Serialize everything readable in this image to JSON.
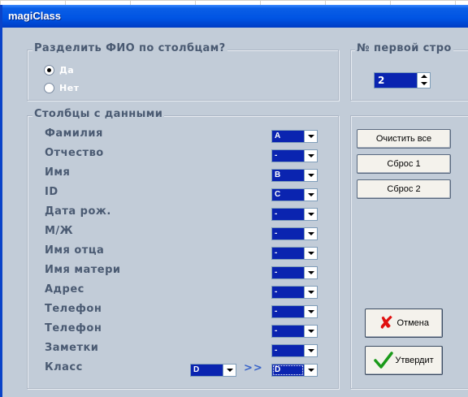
{
  "window": {
    "title": "magiClass"
  },
  "split_group": {
    "legend": "Разделить ФИО по столбцам?",
    "options": [
      {
        "label": "Да",
        "selected": true
      },
      {
        "label": "Нет",
        "selected": false
      }
    ]
  },
  "first_row_group": {
    "legend": "№ первой стро",
    "value": "2"
  },
  "columns_group": {
    "legend": "Столбцы с данными",
    "fields": [
      {
        "label": "Фамилия",
        "value": "A"
      },
      {
        "label": "Отчество",
        "value": "-"
      },
      {
        "label": "Имя",
        "value": "B"
      },
      {
        "label": "ID",
        "value": "C"
      },
      {
        "label": "Дата рож.",
        "value": "-"
      },
      {
        "label": "М/Ж",
        "value": "-"
      },
      {
        "label": "Имя отца",
        "value": "-"
      },
      {
        "label": "Имя матери",
        "value": "-"
      },
      {
        "label": "Адрес",
        "value": "-"
      },
      {
        "label": "Телефон",
        "value": "-"
      },
      {
        "label": "Телефон",
        "value": "-"
      },
      {
        "label": "Заметки",
        "value": "-"
      }
    ],
    "class_row": {
      "label": "Класс",
      "from_value": "D",
      "arrows": ">>",
      "to_value": "D"
    }
  },
  "buttons": {
    "clear_all": "Очистить все",
    "reset1": "Сброс 1",
    "reset2": "Сброс 2",
    "cancel": "Отмена",
    "confirm": "Утвердит"
  },
  "icons": {
    "cancel": "x-icon",
    "confirm": "checkmark-icon"
  },
  "colors": {
    "title_bar": "#0054e3",
    "dialog_bg": "#c2ccd8",
    "selection": "#0a24b0",
    "label_text": "#4a5a72",
    "cancel_icon": "#e01010",
    "confirm_icon": "#1a9a1a"
  }
}
